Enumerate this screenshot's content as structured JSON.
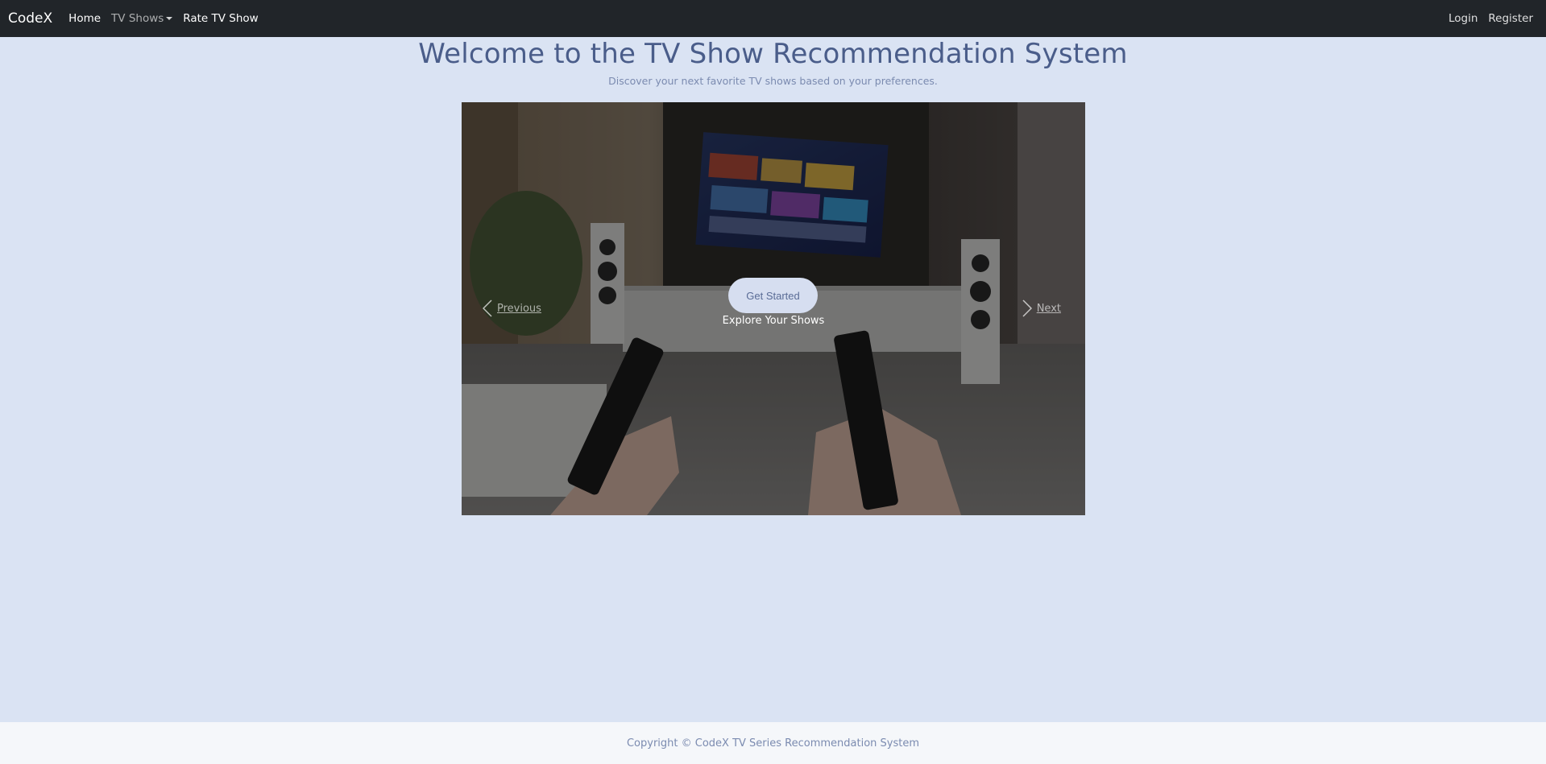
{
  "navbar": {
    "brand": "CodeX",
    "links": [
      {
        "label": "Home"
      },
      {
        "label": "TV Shows"
      },
      {
        "label": "Rate TV Show"
      }
    ],
    "right_links": [
      {
        "label": "Login"
      },
      {
        "label": "Register"
      }
    ]
  },
  "hero": {
    "title": "Welcome to the TV Show Recommendation System",
    "subtitle": "Discover your next favorite TV shows based on your preferences."
  },
  "carousel": {
    "button_label": "Get Started",
    "caption": "Explore Your Shows",
    "prev_label": "Previous",
    "next_label": "Next"
  },
  "footer": {
    "text": "Copyright © CodeX TV Series Recommendation System"
  },
  "colors": {
    "navbar_bg": "#212529",
    "page_bg": "#dae3f3",
    "title": "#4a5d8a",
    "footer_bg": "#f5f7fa"
  },
  "icons": {
    "prev": "chevron-left-icon",
    "next": "chevron-right-icon",
    "dropdown": "caret-down-icon"
  }
}
